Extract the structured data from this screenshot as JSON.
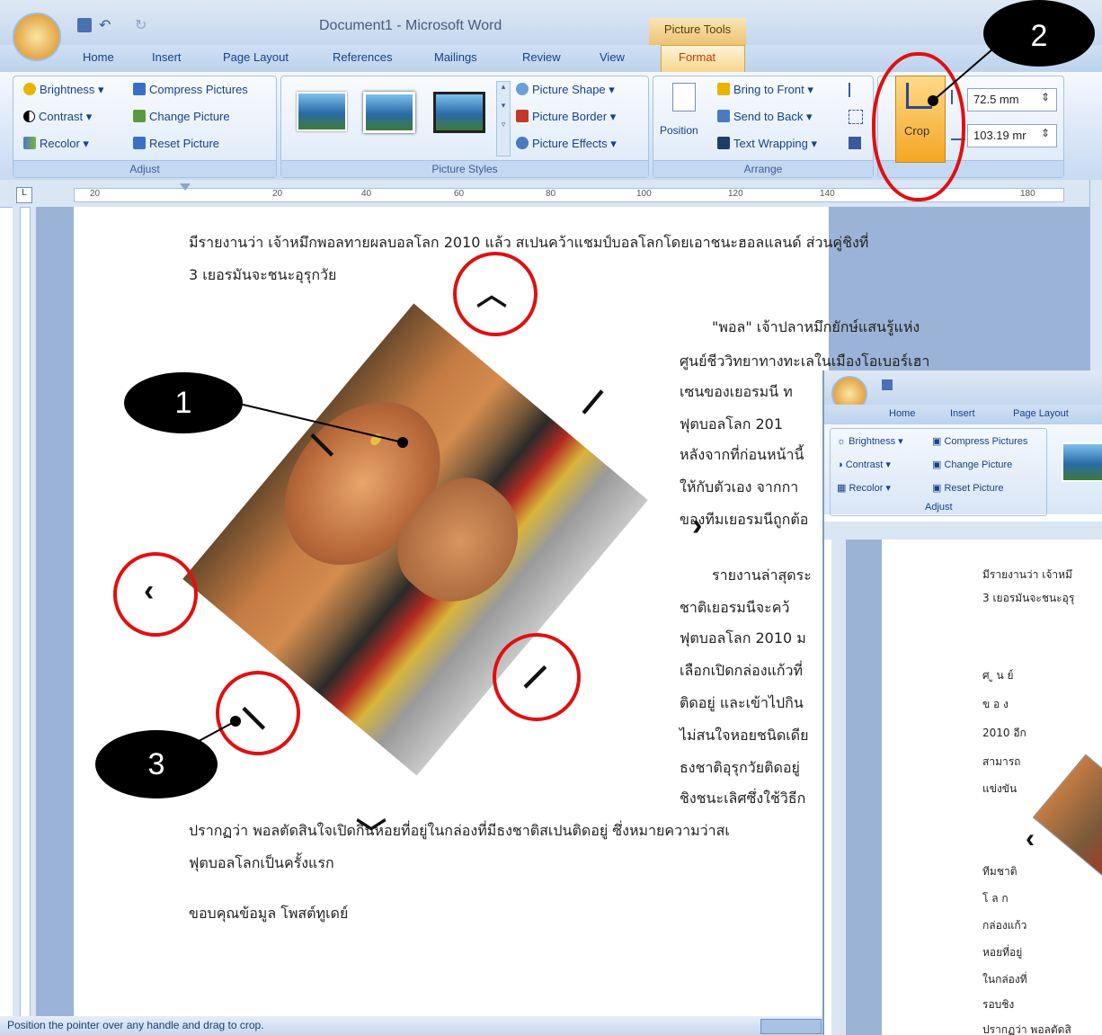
{
  "window": {
    "title": "Document1 - Microsoft Word",
    "context_tab": "Picture Tools"
  },
  "tabs": [
    "Home",
    "Insert",
    "Page Layout",
    "References",
    "Mailings",
    "Review",
    "View",
    "Format"
  ],
  "ribbon": {
    "adjust": {
      "label": "Adjust",
      "brightness": "Brightness",
      "contrast": "Contrast",
      "recolor": "Recolor",
      "compress": "Compress Pictures",
      "change": "Change Picture",
      "reset": "Reset Picture"
    },
    "styles": {
      "label": "Picture Styles",
      "shape": "Picture Shape",
      "border": "Picture Border",
      "effects": "Picture Effects"
    },
    "arrange": {
      "label": "Arrange",
      "position": "Position",
      "front": "Bring to Front",
      "back": "Send to Back",
      "wrap": "Text Wrapping"
    },
    "size": {
      "crop": "Crop",
      "height": "72.5 mm",
      "width": "103.19 mr"
    }
  },
  "ruler_numbers": [
    "20",
    "20",
    "40",
    "60",
    "80",
    "100",
    "120",
    "140",
    "180"
  ],
  "document": {
    "para1_line1": "มีรายงานว่า เจ้าหมึกพอลทายผลบอลโลก 2010 แล้ว สเปนคว้าแชมป์บอลโลกโดยเอาชนะฮอลแลนด์ ส่วนคู่ชิงที่",
    "para1_line2": "3 เยอรมันจะชนะอุรุกวัย",
    "right_lines": [
      "\"พอล\" เจ้าปลาหมึกยักษ์แสนรู้แห่ง",
      "ศูนย์ชีววิทยาทางทะเลในเมืองโอเบอร์เฮา",
      "เซนของเยอรมนี ท",
      "ฟุตบอลโลก 201",
      "หลังจากที่ก่อนหน้านี้",
      "ให้กับตัวเอง จากกา",
      "ของทีมเยอรมนีถูกต้อ"
    ],
    "right_lines2": [
      "รายงานล่าสุดระ",
      "ชาติเยอรมนีจะคว้",
      "ฟุตบอลโลก 2010 ม",
      "เลือกเปิดกล่องแก้วที่",
      "ติดอยู่ และเข้าไปกิน",
      "ไม่สนใจหอยชนิดเดีย",
      "ธงชาติอุรุกวัยติดอยู่",
      "ชิงชนะเลิศซึ่งใช้วิธีก"
    ],
    "para3_line1": "ปรากฏว่า พอลตัดสินใจเปิดกินหอยที่อยู่ในกล่องที่มีธงชาติสเปนติดอยู่ ซึ่งหมายความว่าสเ",
    "para3_line2": "ฟุตบอลโลกเป็นครั้งแรก",
    "credit": "ขอบคุณข้อมูล โพสต์ทูเดย์"
  },
  "callouts": [
    "1",
    "2",
    "3"
  ],
  "status": "Position the pointer over any handle and drag to crop.",
  "win2": {
    "tabs": [
      "Home",
      "Insert",
      "Page Layout"
    ],
    "brightness": "Brightness",
    "contrast": "Contrast",
    "recolor": "Recolor",
    "compress": "Compress Pictures",
    "change": "Change Picture",
    "reset": "Reset Picture",
    "adjust": "Adjust",
    "line1": "มีรายงานว่า เจ้าหมึ",
    "line2": "3 เยอรมันจะชนะอุรุ",
    "col": [
      "ศ ู น ย์",
      "ข อ ง",
      "2010 อีก",
      "สามารถ",
      "แข่งขัน"
    ],
    "col2": [
      "ทีมชาติ",
      "โ ล ก",
      "กล่องแก้ว",
      "หอยที่อยู่",
      "ในกล่องที่",
      "รอบชิง",
      "ปรากฏว่า พอลตัดสิ"
    ]
  }
}
